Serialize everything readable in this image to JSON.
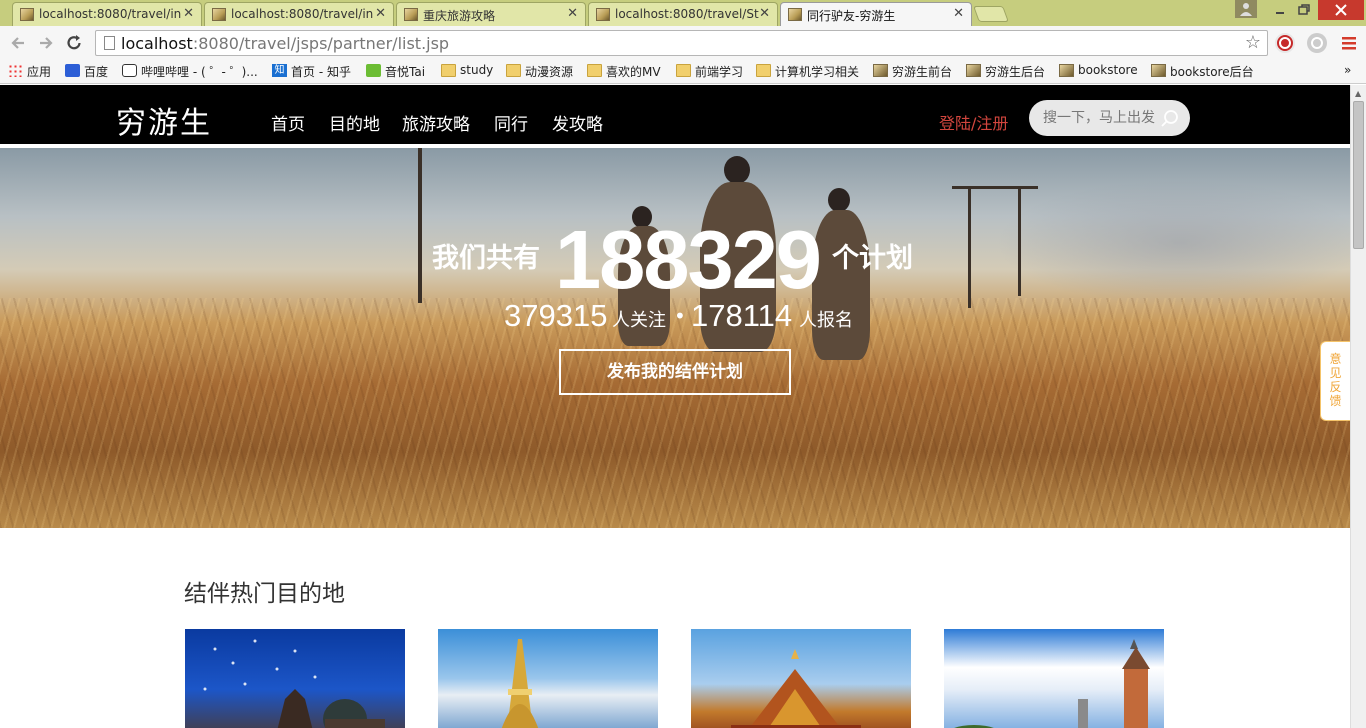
{
  "browser": {
    "tabs": [
      {
        "title": "localhost:8080/travel/in",
        "active": false
      },
      {
        "title": "localhost:8080/travel/in",
        "active": false
      },
      {
        "title": "重庆旅游攻略",
        "active": false
      },
      {
        "title": "localhost:8080/travel/St",
        "active": false
      },
      {
        "title": "同行驴友-穷游生",
        "active": true
      }
    ],
    "url_host": "localhost",
    "url_rest": ":8080/travel/jsps/partner/list.jsp",
    "bookmarks": [
      {
        "label": "应用",
        "icon": "apps-grid-icon"
      },
      {
        "label": "百度",
        "icon": "baidu-paw-icon"
      },
      {
        "label": "哔哩哔哩 - ( ゜- ゜)...",
        "icon": "bilibili-tv-icon"
      },
      {
        "label": "首页 - 知乎",
        "icon": "zhihu-icon"
      },
      {
        "label": "音悦Tai",
        "icon": "yinyuetai-icon"
      },
      {
        "label": "study",
        "icon": "folder-icon"
      },
      {
        "label": "动漫资源",
        "icon": "folder-icon"
      },
      {
        "label": "喜欢的MV",
        "icon": "folder-icon"
      },
      {
        "label": "前端学习",
        "icon": "folder-icon"
      },
      {
        "label": "计算机学习相关",
        "icon": "folder-icon"
      },
      {
        "label": "穷游生前台",
        "icon": "site-image-icon"
      },
      {
        "label": "穷游生后台",
        "icon": "site-image-icon"
      },
      {
        "label": "bookstore",
        "icon": "site-image-icon"
      },
      {
        "label": "bookstore后台",
        "icon": "site-image-icon"
      }
    ]
  },
  "site": {
    "logo": "穷游生",
    "nav": [
      "首页",
      "目的地",
      "旅游攻略",
      "同行",
      "发攻略"
    ],
    "login": "登陆/注册",
    "search_placeholder": "搜一下，马上出发"
  },
  "hero": {
    "pre": "我们共有",
    "plans": "188329",
    "post": "个计划",
    "followers": "379315",
    "followers_label": "人关注",
    "separator": "•",
    "signups": "178114",
    "signups_label": "人报名",
    "button": "发布我的结伴计划"
  },
  "feedback": "意见反馈",
  "section": {
    "title": "结伴热门目的地"
  }
}
